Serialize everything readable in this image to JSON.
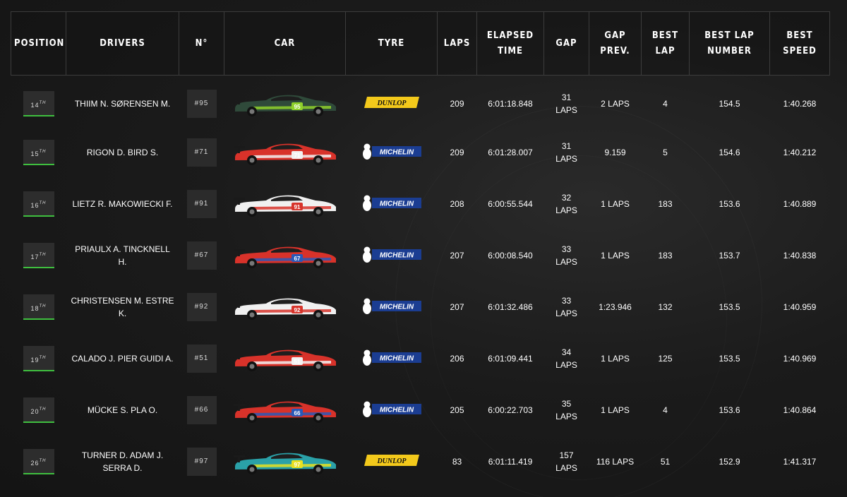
{
  "headers": {
    "position": "POSITION",
    "drivers": "DRIVERS",
    "number": "N°",
    "car": "CAR",
    "tyre": "TYRE",
    "laps": "LAPS",
    "elapsed_time": "ELAPSED TIME",
    "gap": "GAP",
    "gap_prev": "GAP PREV.",
    "best_lap": "BEST LAP",
    "best_lap_number": "BEST LAP NUMBER",
    "best_speed": "BEST SPEED"
  },
  "rows": [
    {
      "pos": "14",
      "suffix": "TH",
      "drivers": "THIIM N. SØRENSEN M.",
      "number": "#95",
      "car_color": "#2f4a3a",
      "car_accent": "#8fd12b",
      "car_num": "95",
      "tyre": "DUNLOP",
      "laps": "209",
      "elapsed": "6:01:18.848",
      "gap_value": "31",
      "gap_unit": "LAPS",
      "gap_prev": "2 LAPS",
      "best_lap": "4",
      "best_lap_number": "154.5",
      "best_speed": "1:40.268"
    },
    {
      "pos": "15",
      "suffix": "TH",
      "drivers": "RIGON D. BIRD S.",
      "number": "#71",
      "car_color": "#d8322a",
      "car_accent": "#f2f2f2",
      "car_num": "71",
      "tyre": "MICHELIN",
      "laps": "209",
      "elapsed": "6:01:28.007",
      "gap_value": "31",
      "gap_unit": "LAPS",
      "gap_prev": "9.159",
      "best_lap": "5",
      "best_lap_number": "154.6",
      "best_speed": "1:40.212"
    },
    {
      "pos": "16",
      "suffix": "TH",
      "drivers": "LIETZ R. MAKOWIECKI F.",
      "number": "#91",
      "car_color": "#f0f0f0",
      "car_accent": "#d7342b",
      "car_num": "91",
      "tyre": "MICHELIN",
      "laps": "208",
      "elapsed": "6:00:55.544",
      "gap_value": "32",
      "gap_unit": "LAPS",
      "gap_prev": "1 LAPS",
      "best_lap": "183",
      "best_lap_number": "153.6",
      "best_speed": "1:40.889"
    },
    {
      "pos": "17",
      "suffix": "TH",
      "drivers": "PRIAULX A. TINCKNELL H.",
      "number": "#67",
      "car_color": "#d8322a",
      "car_accent": "#2a59b8",
      "car_num": "67",
      "tyre": "MICHELIN",
      "laps": "207",
      "elapsed": "6:00:08.540",
      "gap_value": "33",
      "gap_unit": "LAPS",
      "gap_prev": "1 LAPS",
      "best_lap": "183",
      "best_lap_number": "153.7",
      "best_speed": "1:40.838"
    },
    {
      "pos": "18",
      "suffix": "TH",
      "drivers": "CHRISTENSEN M. ESTRE K.",
      "number": "#92",
      "car_color": "#f0f0f0",
      "car_accent": "#d7342b",
      "car_num": "92",
      "tyre": "MICHELIN",
      "laps": "207",
      "elapsed": "6:01:32.486",
      "gap_value": "33",
      "gap_unit": "LAPS",
      "gap_prev": "1:23.946",
      "best_lap": "132",
      "best_lap_number": "153.5",
      "best_speed": "1:40.959"
    },
    {
      "pos": "19",
      "suffix": "TH",
      "drivers": "CALADO J. PIER GUIDI A.",
      "number": "#51",
      "car_color": "#d8322a",
      "car_accent": "#f2f2f2",
      "car_num": "51",
      "tyre": "MICHELIN",
      "laps": "206",
      "elapsed": "6:01:09.441",
      "gap_value": "34",
      "gap_unit": "LAPS",
      "gap_prev": "1 LAPS",
      "best_lap": "125",
      "best_lap_number": "153.5",
      "best_speed": "1:40.969"
    },
    {
      "pos": "20",
      "suffix": "TH",
      "drivers": "MÜCKE S. PLA O.",
      "number": "#66",
      "car_color": "#d8322a",
      "car_accent": "#2a59b8",
      "car_num": "66",
      "tyre": "MICHELIN",
      "laps": "205",
      "elapsed": "6:00:22.703",
      "gap_value": "35",
      "gap_unit": "LAPS",
      "gap_prev": "1 LAPS",
      "best_lap": "4",
      "best_lap_number": "153.6",
      "best_speed": "1:40.864"
    },
    {
      "pos": "26",
      "suffix": "TH",
      "drivers": "TURNER D. ADAM J. SERRA D.",
      "number": "#97",
      "car_color": "#2aa1a8",
      "car_accent": "#e8e020",
      "car_num": "97",
      "tyre": "DUNLOP",
      "laps": "83",
      "elapsed": "6:01:11.419",
      "gap_value": "157",
      "gap_unit": "LAPS",
      "gap_prev": "116 LAPS",
      "best_lap": "51",
      "best_lap_number": "152.9",
      "best_speed": "1:41.317"
    }
  ]
}
